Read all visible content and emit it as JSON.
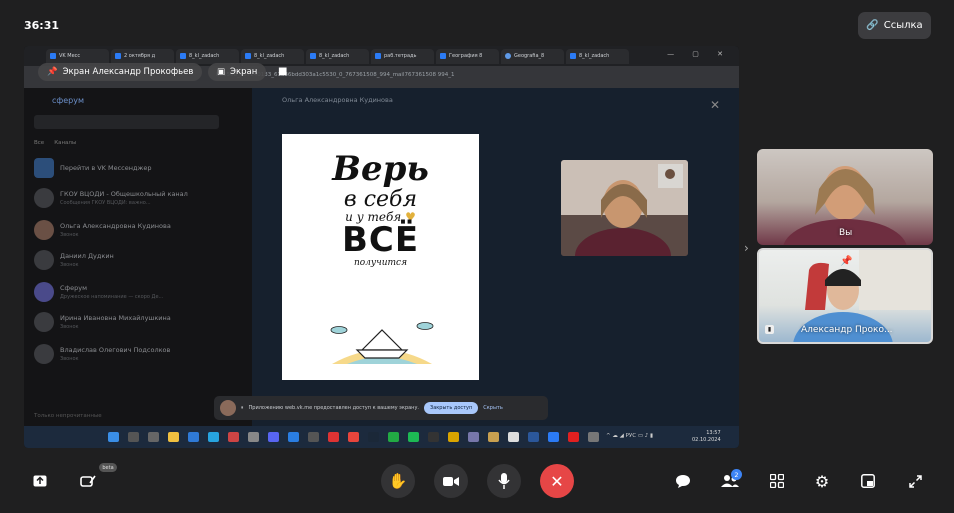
{
  "topbar": {
    "timer": "36:31",
    "link_label": "Ссылка"
  },
  "share": {
    "presenter_label": "Экран Александр Прокофьев",
    "screen_label": "Экран",
    "browser_tabs": [
      "VK Месс",
      "2 октября д",
      "8_kl_zadach",
      "8_kl_zadach",
      "8_kl_zadach",
      "раб.тетрадь",
      "География 8",
      "Geografia_8",
      "8_kl_zadach"
    ],
    "url": "b61508_457240133_61a36bdd303a1c5530_0_767361508_994_mail767361508 994_1",
    "vk_title": "сферум",
    "sidebar_filters": [
      "Все",
      "Каналы"
    ],
    "chats": [
      {
        "name": "Перейти в VK Мессенджер",
        "sub": ""
      },
      {
        "name": "ГКОУ ВЦОДИ - Общешкольный канал",
        "sub": "Сообщения ГКОУ ВЦОДИ: важно..."
      },
      {
        "name": "Ольга Александровна Кудинова",
        "sub": "Звонок"
      },
      {
        "name": "Даниил Дудкин",
        "sub": "Звонок"
      },
      {
        "name": "Сферум",
        "sub": "Дружеское напоминание — скоро Де..."
      },
      {
        "name": "Ирина Ивановна Михайлушкина",
        "sub": "Звонок"
      },
      {
        "name": "Владислав Олегович Подсолков",
        "sub": "Звонок"
      }
    ],
    "sidebar_bottom": "Только непрочитанные",
    "chat_header": "Ольга Александровна Кудинова",
    "poster": {
      "line1": "Верь",
      "line2": "в себя",
      "line3": "и у тебя",
      "line4": "ВСЁ",
      "line5": "получится"
    },
    "notification_text": "Приложению web.vk.me предоставлен доступ к вашему экрану.",
    "notification_close": "Закрыть доступ",
    "notification_hide": "Скрыть",
    "tray_lang": "РУС",
    "clock_time": "13:57",
    "clock_date": "02.10.2024"
  },
  "participants": [
    {
      "name": "Вы"
    },
    {
      "name": "Александр Проко..."
    }
  ],
  "controls": {
    "beta_label": "beta",
    "participants_count": "2"
  }
}
